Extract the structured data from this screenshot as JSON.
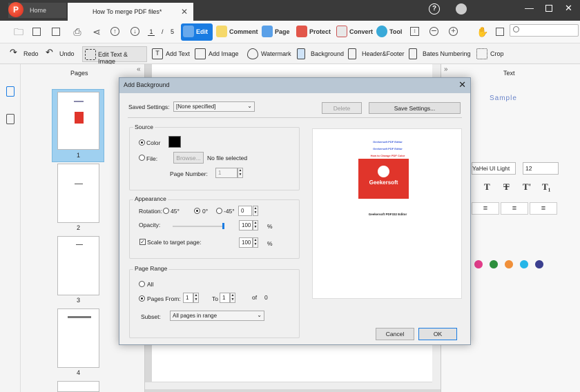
{
  "tabs": {
    "home": "Home",
    "document": "How To merge PDF files*"
  },
  "toolbar1": {
    "current_page": "1",
    "page_sep": "/",
    "total_pages": "5",
    "edit": "Edit",
    "comment": "Comment",
    "page": "Page",
    "protect": "Protect",
    "convert": "Convert",
    "tool": "Tool"
  },
  "toolbar2": {
    "redo": "Redo",
    "undo": "Undo",
    "edit_text_image": "Edit Text & Image",
    "add_text": "Add Text",
    "add_image": "Add Image",
    "watermark": "Watermark",
    "background": "Background",
    "header_footer": "Header&Footer",
    "bates": "Bates Numbering",
    "crop": "Crop"
  },
  "pages_panel": {
    "title": "Pages",
    "collapse": "«",
    "numbers": [
      "1",
      "2",
      "3",
      "4"
    ]
  },
  "right_panel": {
    "collapse": "»",
    "title": "Text",
    "sample": "Sample",
    "font": "YaHei UI Light",
    "size": "12"
  },
  "dialog": {
    "title": "Add Background",
    "saved_settings_label": "Saved Settings:",
    "saved_settings_value": "[None specified]",
    "delete": "Delete",
    "save_settings": "Save Settings...",
    "source": {
      "legend": "Source",
      "color": "Color",
      "file": "File:",
      "browse": "Browse...",
      "no_file": "No file selected",
      "page_number_label": "Page Number:",
      "page_number": "1"
    },
    "appearance": {
      "legend": "Appearance",
      "rotation_label": "Rotation:",
      "r45": "45°",
      "r0": "0°",
      "rm45": "-45°",
      "rotation_value": "0",
      "opacity_label": "Opacity:",
      "opacity_value": "100",
      "opacity_unit": "%",
      "scale_label": "Scale to target page:",
      "scale_value": "100",
      "scale_unit": "%"
    },
    "page_range": {
      "legend": "Page Range",
      "all": "All",
      "pages_from": "Pages From:",
      "from": "1",
      "to_label": "To",
      "to": "1",
      "of": "of",
      "of_count": "0",
      "subset_label": "Subset:",
      "subset_value": "All pages in range"
    },
    "preview": {
      "line1": "Geekersoft PDF Editor",
      "line2": "Geekersoft PDF Editor",
      "line3": "How to Change PDF Color",
      "brand": "Geekersoft",
      "footer": "Geekersoft PDF332 Editor"
    },
    "cancel": "Cancel",
    "ok": "OK"
  },
  "colors": {
    "accent": "#1a7ce2",
    "brand_red": "#e0352b",
    "swatch": "#000000",
    "palette": [
      "#e23d8a",
      "#2d8f3d",
      "#f0903a",
      "#26b6e8",
      "#3b3f8f"
    ]
  }
}
